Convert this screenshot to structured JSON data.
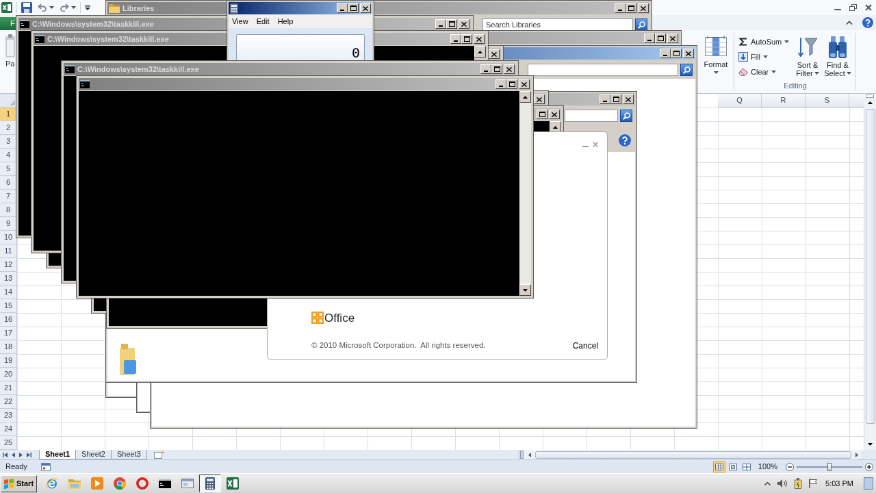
{
  "excel": {
    "file_tab": {
      "label": "F"
    },
    "paste": {
      "label": "Pa"
    },
    "format": {
      "label": "Format"
    },
    "editing": {
      "label": "Editing",
      "commands": [
        {
          "kind": "autosum",
          "label": "AutoSum"
        },
        {
          "kind": "fill",
          "label": "Fill"
        },
        {
          "kind": "clear",
          "label": "Clear"
        }
      ],
      "big_commands": [
        {
          "kind": "sort_filter",
          "lines": [
            "Sort &",
            "Filter"
          ]
        },
        {
          "kind": "find_select",
          "lines": [
            "Find &",
            "Select"
          ]
        }
      ]
    },
    "columns": [
      {
        "label": "Q"
      },
      {
        "label": "R"
      },
      {
        "label": "S"
      }
    ],
    "rows": [
      {
        "label": "1",
        "selected": true
      },
      {
        "label": "2",
        "selected": false
      },
      {
        "label": "3",
        "selected": false
      },
      {
        "label": "4",
        "selected": false
      },
      {
        "label": "5",
        "selected": false
      },
      {
        "label": "6",
        "selected": false
      },
      {
        "label": "7",
        "selected": false
      },
      {
        "label": "8",
        "selected": false
      },
      {
        "label": "9",
        "selected": false
      },
      {
        "label": "10",
        "selected": false
      },
      {
        "label": "11",
        "selected": false
      },
      {
        "label": "12",
        "selected": false
      },
      {
        "label": "13",
        "selected": false
      },
      {
        "label": "14",
        "selected": false
      },
      {
        "label": "15",
        "selected": false
      },
      {
        "label": "16",
        "selected": false
      },
      {
        "label": "17",
        "selected": false
      },
      {
        "label": "18",
        "selected": false
      },
      {
        "label": "19",
        "selected": false
      },
      {
        "label": "20",
        "selected": false
      },
      {
        "label": "21",
        "selected": false
      },
      {
        "label": "22",
        "selected": false
      },
      {
        "label": "23",
        "selected": false
      },
      {
        "label": "24",
        "selected": false
      },
      {
        "label": "25",
        "selected": false
      }
    ],
    "sheet_tabs": [
      {
        "label": "Sheet1",
        "selected": true
      },
      {
        "label": "Sheet2",
        "selected": false
      },
      {
        "label": "Sheet3",
        "selected": false
      }
    ],
    "status_bar": {
      "status": "Ready",
      "views": [
        {
          "kind": "normal",
          "selected": true
        },
        {
          "kind": "page_layout",
          "selected": false
        },
        {
          "kind": "page_break",
          "selected": false
        }
      ],
      "zoom": "100%",
      "zoom_slider": {
        "level": 0.5
      }
    }
  },
  "windows": [
    {
      "kind": "explorer",
      "title": "Libraries",
      "app_icon": true,
      "active": false,
      "controls": [
        {
          "kind": "minimize"
        },
        {
          "kind": "maximize"
        },
        {
          "kind": "close"
        }
      ],
      "search_box": true,
      "search_placeholder": "Search Libraries"
    },
    {
      "kind": "explorer",
      "active": false,
      "controls": [
        {
          "kind": "minimize"
        },
        {
          "kind": "maximize"
        },
        {
          "kind": "close"
        }
      ]
    },
    {
      "kind": "explorer",
      "active": true,
      "controls": [
        {
          "kind": "minimize"
        },
        {
          "kind": "maximize"
        },
        {
          "kind": "close"
        }
      ],
      "search_box": true
    },
    {
      "kind": "explorer",
      "active": false,
      "controls": [
        {
          "kind": "minimize"
        },
        {
          "kind": "maximize"
        },
        {
          "kind": "close"
        }
      ],
      "search_box": true,
      "help_button": true,
      "library_icon": true
    },
    {
      "kind": "console",
      "active": false,
      "controls": [
        {
          "kind": "close"
        }
      ]
    },
    {
      "kind": "console",
      "active": false,
      "controls": [
        {
          "kind": "maximize"
        },
        {
          "kind": "close"
        }
      ],
      "scroll_arrows": [
        {
          "kind": "up"
        }
      ]
    },
    {
      "kind": "splash",
      "logo": "Office",
      "copyright": "© 2010 Microsoft Corporation.  All rights reserved.",
      "button": "Cancel",
      "controls": [
        {
          "kind": "minimize"
        },
        {
          "kind": "close"
        }
      ]
    },
    {
      "kind": "console",
      "active": false,
      "controls": [
        {
          "kind": "close"
        }
      ]
    },
    {
      "kind": "console",
      "title": "C:\\Windows\\system32\\taskkill.exe",
      "app_icon": true,
      "active": false,
      "controls": [
        {
          "kind": "minimize"
        },
        {
          "kind": "maximize"
        },
        {
          "kind": "close"
        }
      ]
    },
    {
      "kind": "console",
      "title": "C:\\Windows\\system32\\taskkill.exe",
      "app_icon": true,
      "active": false,
      "controls": [
        {
          "kind": "minimize"
        },
        {
          "kind": "maximize"
        },
        {
          "kind": "close"
        }
      ],
      "scroll_arrows": [
        {
          "kind": "up"
        }
      ]
    },
    {
      "kind": "calculator",
      "app_icon": true,
      "active": true,
      "controls": [
        {
          "kind": "minimize"
        },
        {
          "kind": "maximize"
        },
        {
          "kind": "close"
        }
      ],
      "menu": [
        {
          "label": "View"
        },
        {
          "label": "Edit"
        },
        {
          "label": "Help"
        }
      ],
      "display": "0"
    },
    {
      "kind": "console",
      "title": "C:\\Windows\\system32\\taskkill.exe",
      "app_icon": true,
      "active": false,
      "controls": [
        {
          "kind": "minimize"
        },
        {
          "kind": "maximize"
        },
        {
          "kind": "close"
        }
      ]
    },
    {
      "kind": "console",
      "app_icon": true,
      "active": false,
      "controls": [
        {
          "kind": "minimize"
        },
        {
          "kind": "maximize"
        },
        {
          "kind": "close"
        }
      ],
      "scroll_arrows": [
        {
          "kind": "up"
        },
        {
          "kind": "down"
        }
      ]
    }
  ],
  "taskbar": {
    "start": "Start",
    "apps": [
      {
        "kind": "e_browser",
        "selected": false
      },
      {
        "kind": "folder",
        "selected": false
      },
      {
        "kind": "player",
        "selected": false
      },
      {
        "kind": "round_browser",
        "selected": false
      },
      {
        "kind": "o_browser",
        "selected": false
      },
      {
        "kind": "console",
        "selected": false
      },
      {
        "kind": "window",
        "selected": false
      },
      {
        "kind": "calculator",
        "selected": true
      },
      {
        "kind": "spreadsheet",
        "selected": false
      }
    ],
    "clock": "5:03 PM"
  }
}
